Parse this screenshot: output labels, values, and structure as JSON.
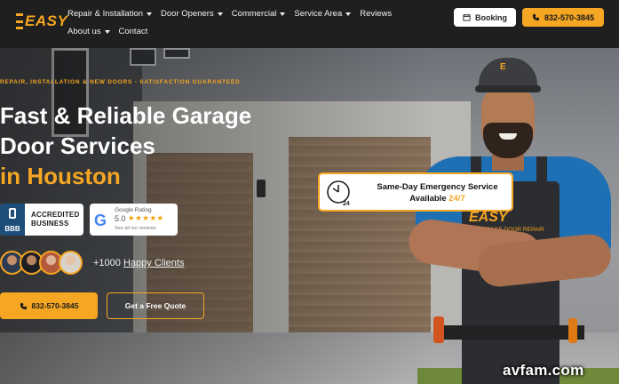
{
  "header": {
    "logo_text": "EASY",
    "nav": [
      {
        "label": "Repair & Installation",
        "dropdown": true
      },
      {
        "label": "Door Openers",
        "dropdown": true
      },
      {
        "label": "Commercial",
        "dropdown": true
      },
      {
        "label": "Service Area",
        "dropdown": true
      },
      {
        "label": "Reviews",
        "dropdown": false
      },
      {
        "label": "About us",
        "dropdown": true
      },
      {
        "label": "Contact",
        "dropdown": false
      }
    ],
    "booking_label": "Booking",
    "phone_label": "832-570-3845"
  },
  "hero": {
    "eyebrow": "REPAIR, INSTALLATION & NEW DOORS - SATISFACTION GUARANTEED",
    "headline_line1": "Fast & Reliable Garage",
    "headline_line2": "Door Services",
    "headline_line3": "in Houston",
    "bbb": {
      "mark": "BBB",
      "line1": "ACCREDITED",
      "line2": "BUSINESS"
    },
    "google": {
      "title": "Google Rating",
      "score": "5.0",
      "stars": "★★★★★",
      "subtitle": "See all our reviews"
    },
    "clients_prefix": "+1000",
    "clients_link": "Happy Clients",
    "cta_phone_label": "832-570-3845",
    "cta_quote_label": "Get a Free Quote"
  },
  "emergency": {
    "title": "Same-Day Emergency Service",
    "sub_prefix": "Available",
    "sub_highlight": "24/7",
    "clock_label": "24"
  },
  "worker": {
    "cap_logo": "E",
    "apron_logo": "EASY",
    "apron_sub": "GARAGE DOOR REPAIR"
  },
  "watermark": "avfam.com",
  "colors": {
    "accent": "#f5a623",
    "header_bg": "#1f1f1f",
    "shirt": "#1f6fb4"
  },
  "icons": {
    "booking": "calendar-icon",
    "phone": "phone-icon",
    "clock": "clock-24-icon",
    "caret": "chevron-down-icon"
  }
}
